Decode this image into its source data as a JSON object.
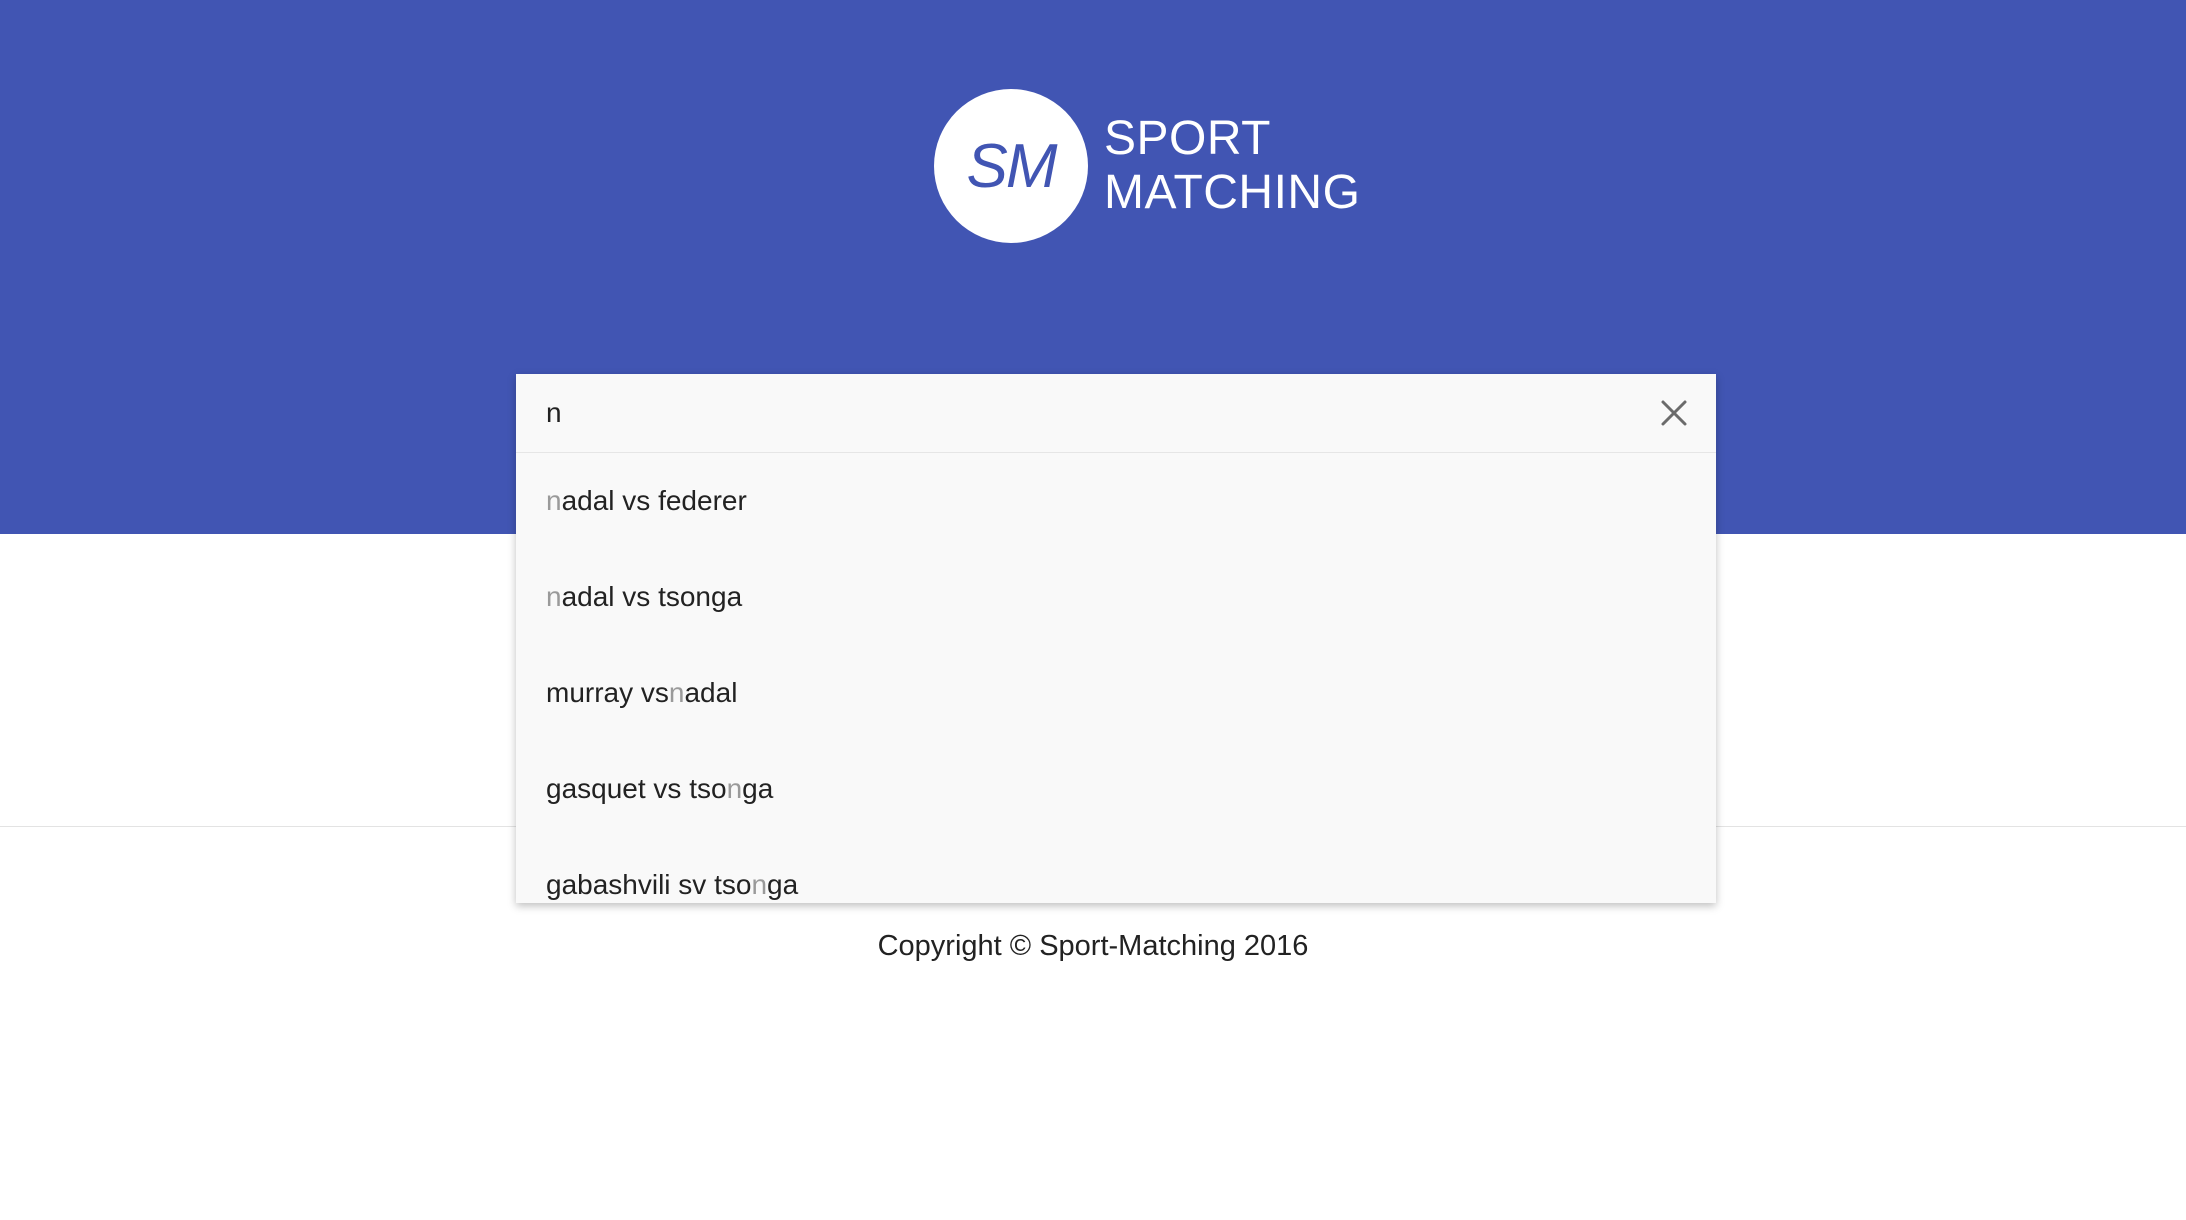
{
  "logo": {
    "mark": "SM",
    "line1": "SPORT",
    "line2": "MATCHING"
  },
  "search": {
    "value": "n",
    "placeholder": "",
    "clear_icon": "close-icon"
  },
  "suggestions": [
    {
      "before": "",
      "match": "n",
      "after": "adal vs federer"
    },
    {
      "before": "",
      "match": "n",
      "after": "adal vs tsonga"
    },
    {
      "before": "murray vs ",
      "match": "n",
      "after": "adal"
    },
    {
      "before": "gasquet vs tso",
      "match": "n",
      "after": "ga"
    },
    {
      "before": "gabashvili sv tso",
      "match": "n",
      "after": "ga"
    }
  ],
  "footer": {
    "copyright": "Copyright © Sport-Matching 2016"
  },
  "colors": {
    "header_bg": "#4155b3",
    "page_bg": "#ffffff",
    "dropdown_bg": "#f9f9f9",
    "highlight_text": "#9a9a9a"
  }
}
